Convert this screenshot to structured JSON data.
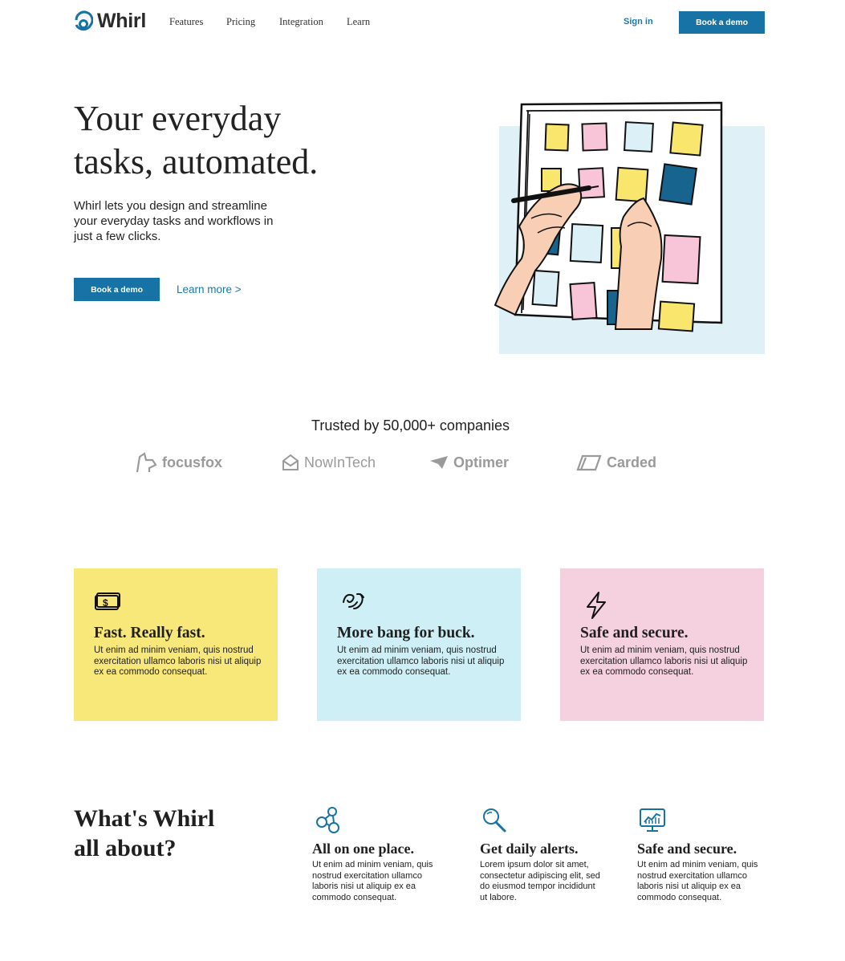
{
  "nav": {
    "logo_text": "Whirl",
    "links": [
      "Features",
      "Pricing",
      "Integration",
      "Learn"
    ],
    "sign_in": "Sign in",
    "book_demo": "Book a demo"
  },
  "hero": {
    "title_line1": "Your everyday",
    "title_line2": "tasks, automated.",
    "description": "Whirl lets you design and streamline your everyday tasks and workflows in just a few clicks.",
    "cta": "Book a demo",
    "learn_more": "Learn more >"
  },
  "trusted": {
    "heading": "Trusted by 50,000+ companies",
    "logos": [
      "focusfox",
      "NowInTech",
      "Optimer",
      "Carded"
    ]
  },
  "features": [
    {
      "icon": "money-icon",
      "title": "Fast. Really fast.",
      "text": "Ut enim ad minim veniam, quis nostrud exercitation ullamco laboris nisi ut aliquip ex ea commodo consequat.",
      "color": "#f8e87a"
    },
    {
      "icon": "handshake-icon",
      "title": "More bang for buck.",
      "text": "Ut enim ad minim veniam, quis nostrud exercitation ullamco laboris nisi ut aliquip ex ea commodo consequat.",
      "color": "#cdeff5"
    },
    {
      "icon": "lightning-icon",
      "title": "Safe and secure.",
      "text": "Ut enim ad minim veniam, quis nostrud exercitation ullamco laboris nisi ut aliquip ex ea commodo consequat.",
      "color": "#f5d0de"
    }
  ],
  "about": {
    "title_line1": "What's Whirl",
    "title_line2": "all about?",
    "items": [
      {
        "icon": "network-icon",
        "title": "All on one place.",
        "text": "Ut enim ad minim veniam, quis nostrud exercitation ullamco laboris nisi ut aliquip ex ea commodo consequat."
      },
      {
        "icon": "magnifier-icon",
        "title": "Get daily alerts.",
        "text": "Lorem ipsum dolor sit amet, consectetur adipiscing elit, sed do eiusmod tempor incididunt ut labore."
      },
      {
        "icon": "monitor-chart-icon",
        "title": "Safe and secure.",
        "text": "Ut enim ad minim veniam, quis nostrud exercitation ullamco laboris nisi ut aliquip ex ea commodo consequat."
      }
    ]
  },
  "colors": {
    "accent": "#1772a6",
    "link": "#1b79a8"
  }
}
